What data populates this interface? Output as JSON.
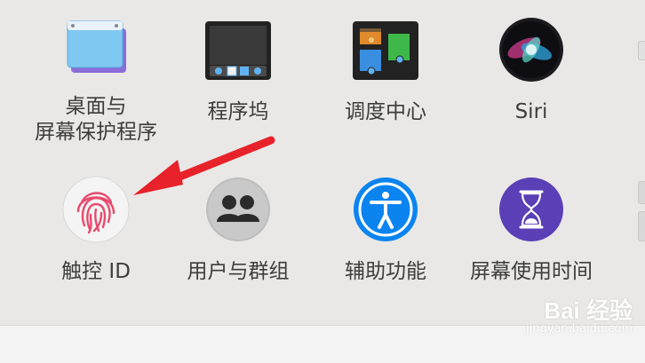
{
  "prefs": {
    "desktop": {
      "label_line1": "桌面与",
      "label_line2": "屏幕保护程序"
    },
    "dock": {
      "label": "程序坞"
    },
    "mission_control": {
      "label": "调度中心"
    },
    "siri": {
      "label": "Siri"
    },
    "touch_id": {
      "label": "触控 ID"
    },
    "users": {
      "label": "用户与群组"
    },
    "accessibility": {
      "label": "辅助功能"
    },
    "screen_time": {
      "label": "屏幕使用时间"
    }
  },
  "annotation": {
    "arrow_color": "#e8222a"
  },
  "watermark": {
    "brand": "Bai 经验",
    "site": "jingyan.baidu.com"
  },
  "colors": {
    "background": "#e9e8e7",
    "label": "#3d3d3d",
    "accessibility_blue": "#0b84f0",
    "screen_time_purple": "#5a3fb7",
    "fingerprint_pink": "#e84a6e"
  }
}
